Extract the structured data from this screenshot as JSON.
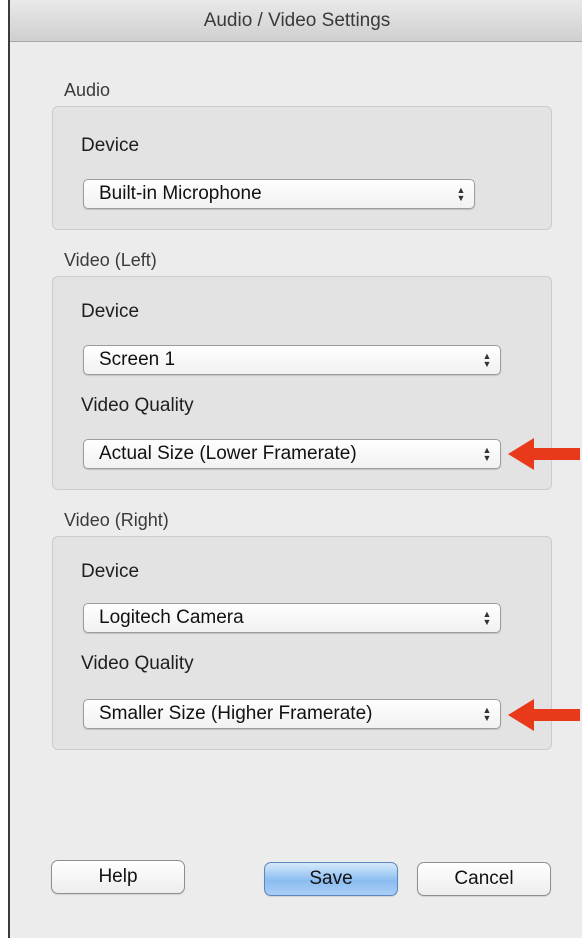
{
  "window": {
    "title": "Audio / Video Settings"
  },
  "audio": {
    "section_label": "Audio",
    "device_label": "Device",
    "device_value": "Built-in Microphone"
  },
  "video_left": {
    "section_label": "Video (Left)",
    "device_label": "Device",
    "device_value": "Screen 1",
    "quality_label": "Video Quality",
    "quality_value": "Actual Size (Lower Framerate)"
  },
  "video_right": {
    "section_label": "Video (Right)",
    "device_label": "Device",
    "device_value": "Logitech Camera",
    "quality_label": "Video Quality",
    "quality_value": "Smaller Size (Higher Framerate)"
  },
  "buttons": {
    "help_label": "Help",
    "save_label": "Save",
    "cancel_label": "Cancel"
  },
  "annotations": {
    "arrow_color": "#e8391a"
  },
  "icons": {
    "popup_stepper": "up-down-arrows-icon",
    "annotation": "red-arrow-icon"
  }
}
